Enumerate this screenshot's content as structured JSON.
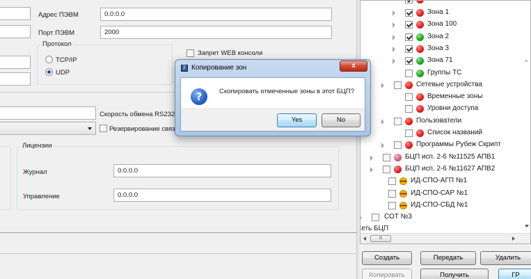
{
  "form": {
    "pc_address_label": "Адрес ПЭВМ",
    "pc_address_value": "0.0.0.0",
    "pc_port_label": "Порт ПЭВМ",
    "pc_port_value": "2000",
    "protocol_title": "Протокол",
    "protocol_tcp": "TCP/IP",
    "protocol_udp": "UDP",
    "web_console_label": "Запрет WEB консоли",
    "rs232_speed_label": "Скорость обмена RS232",
    "redundancy_label": "Резервирование связи",
    "licenses_title": "Лицензии",
    "journal_label": "Журнал",
    "journal_value": "0.0.0.0",
    "control_label": "Управление",
    "control_value": "0.0.0.0"
  },
  "dialog": {
    "title": "Копирование зон",
    "message": "Скопировать отмеченные зоны в этот БЦП?",
    "yes_label": "Yes",
    "no_label": "No",
    "close_glyph": "x",
    "icon": "question-icon"
  },
  "tree": {
    "items": [
      {
        "label": "Зона 1",
        "indicator": "red",
        "checked": true
      },
      {
        "label": "Зона 100",
        "indicator": "red",
        "checked": true
      },
      {
        "label": "Зона 2",
        "indicator": "green",
        "checked": true
      },
      {
        "label": "Зона 3",
        "indicator": "red",
        "checked": true
      },
      {
        "label": "Зона 71",
        "indicator": "green",
        "checked": true
      },
      {
        "label": "Группы ТС",
        "indicator": "green",
        "checked": false
      },
      {
        "label": "Сетевые устройства",
        "indicator": "red",
        "checked": false
      },
      {
        "label": "Временные зоны",
        "indicator": "red",
        "checked": false
      },
      {
        "label": "Уровни доступа",
        "indicator": "red",
        "checked": false
      },
      {
        "label": "Пользователи",
        "indicator": "red",
        "checked": false
      },
      {
        "label": "Список названий",
        "indicator": "red",
        "checked": false
      },
      {
        "label": "Программы Рубеж Скрипт",
        "indicator": "red",
        "checked": false
      },
      {
        "label": "БЦП исп. 2-6 №11525 АПВ1",
        "indicator": "pink",
        "checked": false
      },
      {
        "label": "БЦП исп. 2-6 №11627 АПВ2",
        "indicator": "red",
        "checked": false
      },
      {
        "label": "ИД-СПО-АГП №1",
        "indicator": "idspo",
        "checked": false
      },
      {
        "label": "ИД-СПО-САР №1",
        "indicator": "idspo",
        "checked": false
      },
      {
        "label": "ИД-СПО-СБД №1",
        "indicator": "idspo",
        "checked": false
      },
      {
        "label": "СОТ №3",
        "indicator": "none",
        "checked": false
      },
      {
        "label": "Сеть БЦП",
        "indicator": "none",
        "checked": false
      }
    ],
    "scroll_thumb_label": "III"
  },
  "actions": {
    "create": "Создать",
    "transfer": "Передать",
    "delete": "Удалить",
    "copy": "Копировать",
    "receive": "Получить",
    "gr": "ГР"
  }
}
